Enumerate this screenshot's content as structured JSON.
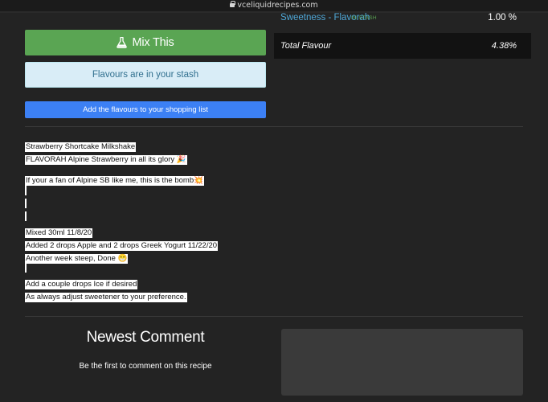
{
  "browser": {
    "url": "vceliquidrecipes.com"
  },
  "actions": {
    "mix_label": "Mix This",
    "stash_label": "Flavours are in your stash",
    "shopping_label": "Add the flavours to your shopping list"
  },
  "flavours": [
    {
      "name": "Sweetness - Flavorah",
      "badge": "IN STASH",
      "percent": "1.00 %"
    }
  ],
  "total": {
    "label": "Total Flavour",
    "percent": "4.38%"
  },
  "description": [
    "Strawberry Shortcake Milkshake",
    "FLAVORAH Alpine Strawberry in all its glory 🎉",
    "If your a fan of Alpine SB like me, this is the bomb💥",
    "",
    "",
    "",
    "Mixed 30ml 11/8/20",
    "Added 2 drops Apple and 2 drops Greek Yogurt 11/22/20",
    "Another week steep, Done 😁",
    "",
    "Add a couple drops Ice if desired",
    "As always adjust sweetener to your preference."
  ],
  "comments": {
    "title": "Newest Comment",
    "empty_text": "Be the first to comment on this recipe"
  },
  "colors": {
    "background": "#232323",
    "mix_green": "#5aa553",
    "info_bg": "#d9edf7",
    "info_text": "#31708f",
    "primary_blue": "#3c80f5",
    "flavour_link": "#4fa8d8"
  }
}
